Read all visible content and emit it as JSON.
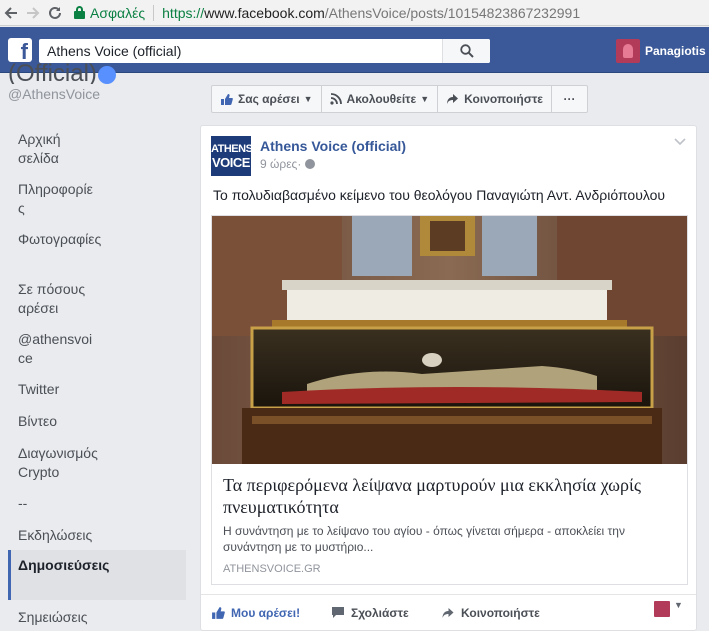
{
  "browser": {
    "secure_label": "Ασφαλές",
    "url_scheme": "https://",
    "url_host": "www.facebook.com",
    "url_path": "/AthensVoice/posts/10154823867232991"
  },
  "header": {
    "search_value": "Athens Voice (official)",
    "profile_name": "Panagiotis"
  },
  "sidebar": {
    "page_name_partial": "(Official)",
    "page_handle": "@AthensVoice",
    "items": [
      {
        "label": "Αρχική σελίδα"
      },
      {
        "label": "Πληροφορίες"
      },
      {
        "label": "Φωτογραφίες"
      },
      {
        "label": "Σε πόσους αρέσει"
      },
      {
        "label": "@athensvoice"
      },
      {
        "label": "Twitter"
      },
      {
        "label": "Βίντεο"
      },
      {
        "label": "Διαγωνισμός Crypto"
      },
      {
        "label": "--"
      },
      {
        "label": "Εκδηλώσεις"
      },
      {
        "label": "Δημοσιεύσεις"
      },
      {
        "label": "Σημειώσεις"
      }
    ],
    "active_item": "Δημοσιεύσεις"
  },
  "page_actions": {
    "like": "Σας αρέσει",
    "follow": "Ακολουθείτε",
    "share": "Κοινοποιήστε",
    "more": "···"
  },
  "post": {
    "author": "Athens Voice (official)",
    "logo_line1": "ATHENS",
    "logo_line2": "VOICE",
    "time": "9 ώρες",
    "meta_sep": " · ",
    "text": "Το πολυδιαβασμένο κείμενο του θεολόγου Παναγιώτη Αντ. Ανδριόπουλου",
    "link": {
      "title": "Τα περιφερόμενα λείψανα μαρτυρούν μια εκκλησία χωρίς πνευματικότητα",
      "description": "Η συνάντηση με το λείψανο του αγίου - όπως γίνεται σήμερα - αποκλείει την συνάντηση με το μυστήριο...",
      "domain": "ATHENSVOICE.GR"
    },
    "footer": {
      "like": "Μου αρέσει!",
      "comment": "Σχολιάστε",
      "share": "Κοινοποιήστε"
    }
  },
  "colors": {
    "facebook_blue": "#3b5998",
    "link_blue": "#365899",
    "secure_green": "#0b8043"
  }
}
